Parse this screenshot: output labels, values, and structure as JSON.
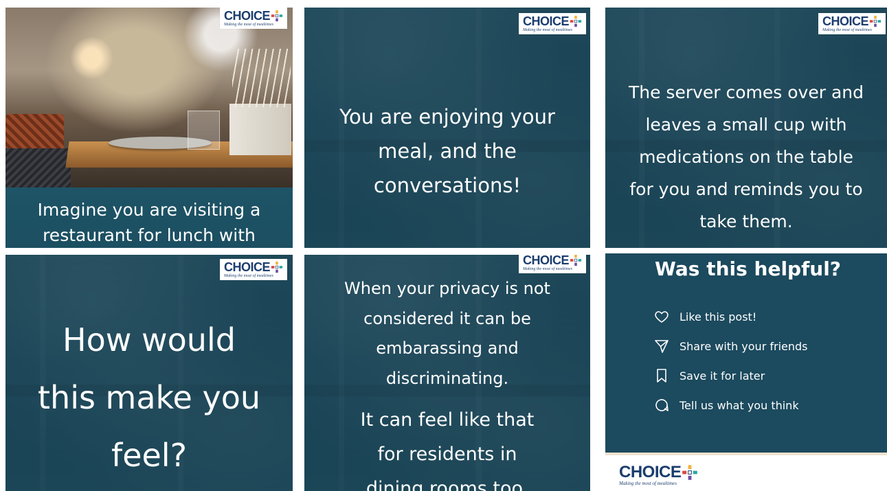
{
  "brand": {
    "logo_word": "CHOICE",
    "logo_tagline": "Making the most of mealtimes",
    "colors": {
      "navy": "#1b3d6e",
      "plus_yellow": "#f0b43c",
      "plus_teal": "#2aa7a0",
      "plus_purple": "#6b4ea0",
      "plus_red": "#d8473f"
    }
  },
  "slides": [
    {
      "lines": [
        "Imagine you are visiting a",
        "restaurant for lunch with"
      ]
    },
    {
      "lines": [
        "You are enjoying your",
        "meal, and the",
        "conversations!"
      ]
    },
    {
      "lines": [
        "The server comes over and",
        "leaves a small cup with",
        "medications on the table",
        "for you and reminds you to",
        "take them."
      ]
    },
    {
      "lines": [
        "How would",
        "this make you",
        "feel?"
      ]
    },
    {
      "lines": [
        "When your privacy is not",
        "considered it can be",
        "embarassing and",
        "discriminating."
      ],
      "lines2": [
        "It can feel like that",
        "for residents in",
        "dining rooms too."
      ]
    },
    {
      "title": "Was this helpful?",
      "items": [
        {
          "icon": "heart-icon",
          "label": "Like this post!"
        },
        {
          "icon": "send-icon",
          "label": "Share with your friends"
        },
        {
          "icon": "bookmark-icon",
          "label": "Save it for later"
        },
        {
          "icon": "comment-icon",
          "label": "Tell us what you think"
        }
      ]
    }
  ]
}
